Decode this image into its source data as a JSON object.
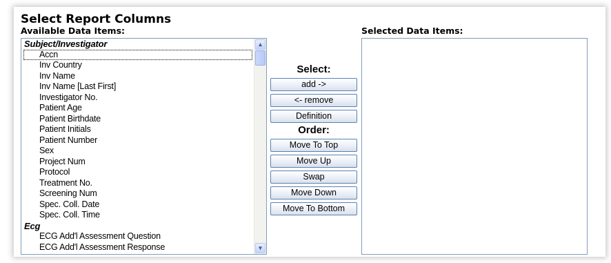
{
  "header": {
    "title": "Select Report Columns",
    "available_label": "Available Data Items:",
    "selected_label": "Selected Data Items:"
  },
  "available_list": {
    "rows": [
      {
        "text": "Subject/Investigator",
        "group": true
      },
      {
        "text": "Accn",
        "focused": true
      },
      {
        "text": "Inv Country"
      },
      {
        "text": "Inv Name"
      },
      {
        "text": "Inv Name [Last First]"
      },
      {
        "text": "Investigator No."
      },
      {
        "text": "Patient Age"
      },
      {
        "text": "Patient Birthdate"
      },
      {
        "text": "Patient Initials"
      },
      {
        "text": "Patient Number"
      },
      {
        "text": "Sex"
      },
      {
        "text": "Project Num"
      },
      {
        "text": "Protocol"
      },
      {
        "text": "Treatment No."
      },
      {
        "text": "Screening Num"
      },
      {
        "text": "Spec. Coll. Date"
      },
      {
        "text": "Spec. Coll. Time"
      },
      {
        "text": "Ecg",
        "group": true
      },
      {
        "text": "ECG Add'l Assessment Question"
      },
      {
        "text": "ECG Add'l Assessment Response"
      }
    ],
    "scroll_up_icon": "▴",
    "scroll_down_icon": "▾"
  },
  "controls": {
    "select_heading": "Select:",
    "add_label": "add ->",
    "remove_label": "<- remove",
    "definition_label": "Definition",
    "order_heading": "Order:",
    "move_top_label": "Move To Top",
    "move_up_label": "Move Up",
    "swap_label": "Swap",
    "move_down_label": "Move Down",
    "move_bottom_label": "Move To Bottom"
  },
  "selected_list": {
    "rows": []
  }
}
